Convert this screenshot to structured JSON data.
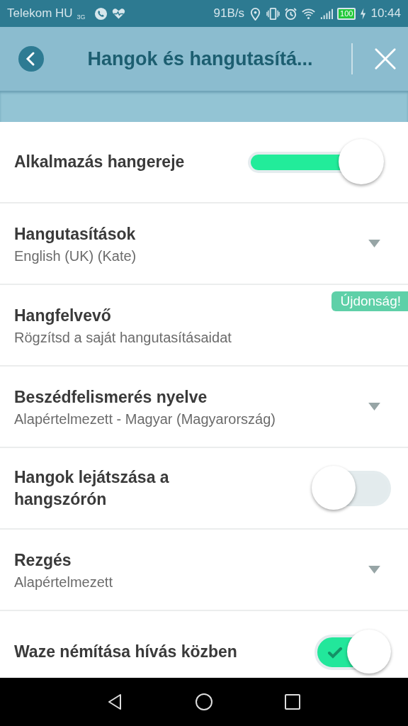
{
  "status_bar": {
    "carrier": "Telekom HU",
    "network": "3G",
    "speed": "91B/s",
    "battery": "100",
    "time": "10:44"
  },
  "header": {
    "title": "Hangok és hangutasítá..."
  },
  "settings": [
    {
      "kind": "slider",
      "label": "Alkalmazás hangereje",
      "level": 0.85
    },
    {
      "kind": "dropdown",
      "label": "Hangutasítások",
      "value": "English (UK) (Kate)"
    },
    {
      "kind": "link",
      "label": "Hangfelvevő",
      "value": "Rögzítsd a saját hangutasításaidat",
      "badge": "Újdonság!"
    },
    {
      "kind": "dropdown",
      "label": "Beszédfelismerés nyelve",
      "value": "Alapértelmezett - Magyar (Magyarország)"
    },
    {
      "kind": "toggle",
      "label": "Hangok lejátszása a hangszórón",
      "on": false
    },
    {
      "kind": "dropdown",
      "label": "Rezgés",
      "value": "Alapértelmezett"
    },
    {
      "kind": "toggle",
      "label": "Waze némítása hívás közben",
      "on": true
    }
  ]
}
